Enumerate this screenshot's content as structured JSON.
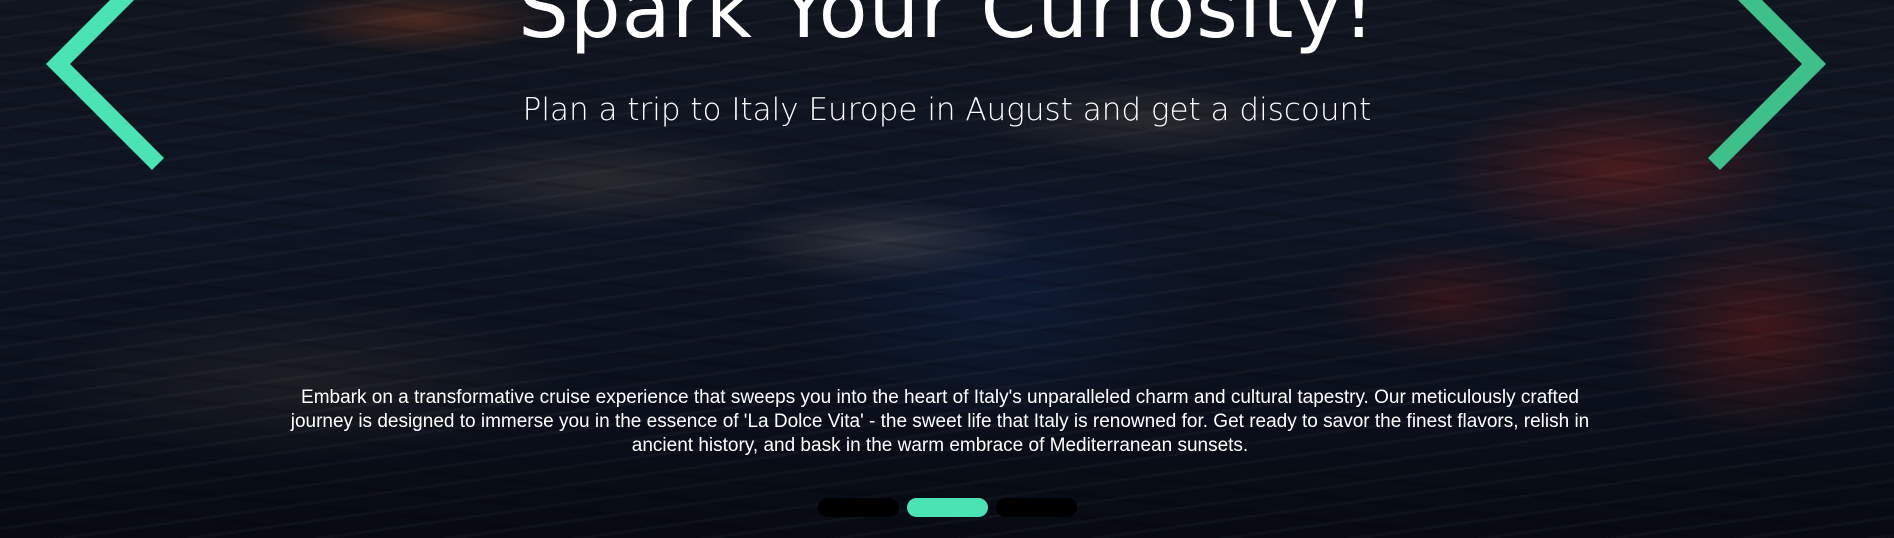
{
  "hero": {
    "headline": "Spark Your Curiosity!",
    "subhead": "Plan a trip to Italy Europe in August and get a discount",
    "description": "Embark on a transformative cruise experience that sweeps you into the heart of Italy's unparalleled charm and cultural tapestry. Our meticulously crafted journey is designed to immerse you in the essence of 'La Dolce Vita' - the sweet life that Italy is renowned for. Get ready to savor the finest flavors, relish in ancient history, and bask in the warm embrace of Mediterranean sunsets."
  },
  "carousel": {
    "prev_icon": "chevron-left-icon",
    "next_icon": "chevron-right-icon",
    "slide_count": 3,
    "active_index": 1
  },
  "colors": {
    "accent": "#4be3b3",
    "accent_dim": "#3fbf8a",
    "dot_inactive": "#000000",
    "text": "#ffffff"
  }
}
